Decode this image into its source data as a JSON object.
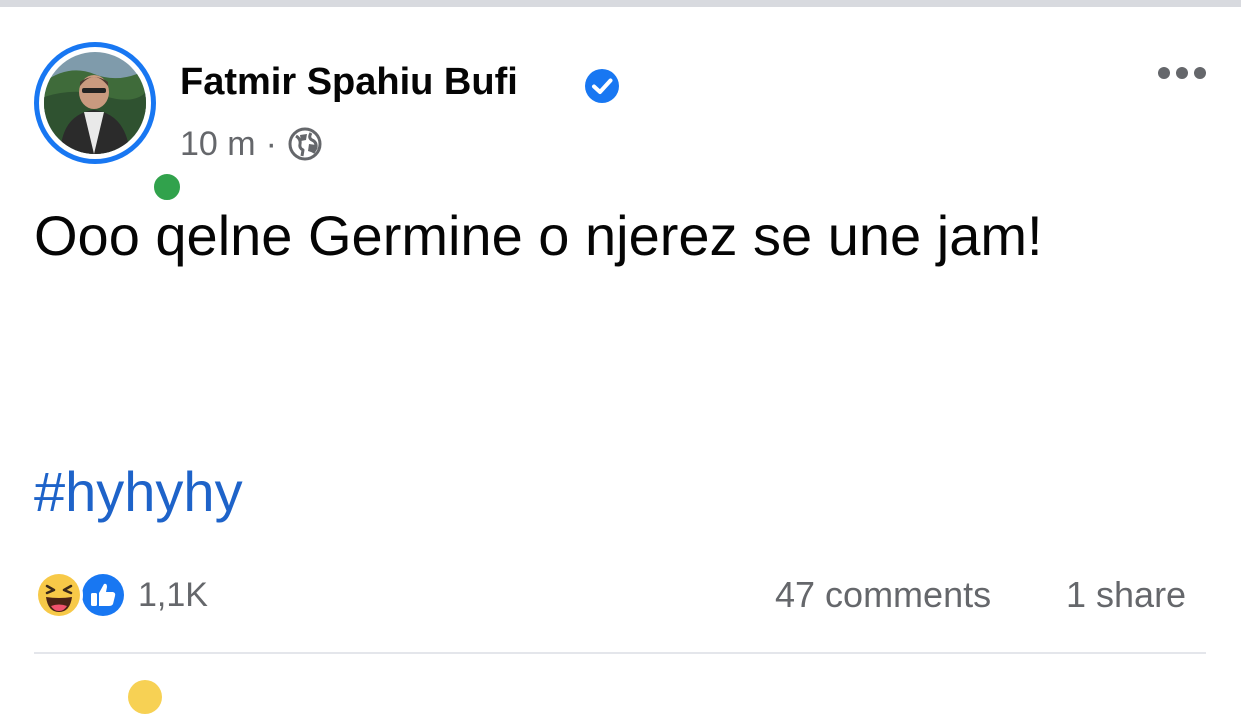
{
  "post": {
    "author": "Fatmir Spahiu Bufi",
    "time": "10 m",
    "separator": "·",
    "privacy_icon": "globe-icon",
    "verified_icon": "verified-badge-icon",
    "more_icon": "more-options-icon",
    "text": "Ooo qelne Germine o njerez se une jam!",
    "hashtag": "#hyhyhy"
  },
  "engagement": {
    "reaction_icons": [
      "haha-icon",
      "like-icon"
    ],
    "reactions_count": "1,1K",
    "comments": "47 comments",
    "shares": "1 share"
  },
  "colors": {
    "accent": "#1877f2",
    "online": "#31a24c",
    "hashtag": "#1e63c9",
    "secondary_text": "#65676b"
  }
}
